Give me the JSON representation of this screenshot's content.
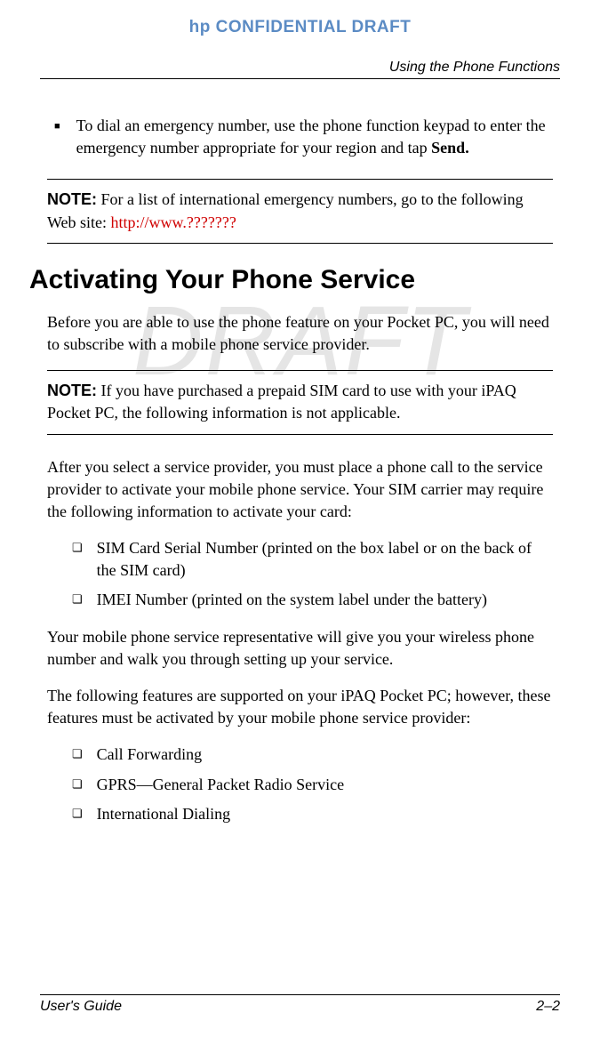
{
  "header": {
    "confidential": "hp CONFIDENTIAL DRAFT",
    "chapter": "Using the Phone Functions"
  },
  "watermark": "DRAFT",
  "bullet": {
    "text_a": "To dial an emergency number, use the phone function keypad to enter the emergency number appropriate for your region and tap ",
    "text_b": "Send."
  },
  "note1": {
    "label": "NOTE:",
    "text": " For a list of international emergency numbers, go to the following Web site: ",
    "url": "http://www.???????"
  },
  "section": {
    "heading": "Activating Your Phone Service",
    "intro": "Before you are able to use the phone feature on your Pocket PC, you will need to subscribe with a mobile phone service provider."
  },
  "note2": {
    "label": "NOTE:",
    "text": " If you have purchased a prepaid SIM card to use with your iPAQ Pocket PC, the following information is not applicable."
  },
  "para1": "After you select a service provider, you must place a phone call to the service provider to activate your mobile phone service. Your SIM carrier may require the following information to activate your card:",
  "list1": {
    "item1": "SIM Card Serial Number (printed on the box label or on the back of the SIM card)",
    "item2": "IMEI Number (printed on the system label under the battery)"
  },
  "para2": "Your mobile phone service representative will give you your wireless phone number and walk you through setting up your service.",
  "para3": "The following features are supported on your iPAQ Pocket PC; however, these features must be activated by your mobile phone service provider:",
  "list2": {
    "item1": "Call Forwarding",
    "item2": "GPRS—General Packet Radio Service",
    "item3": "International Dialing"
  },
  "footer": {
    "left": "User's Guide",
    "right": "2–2"
  }
}
